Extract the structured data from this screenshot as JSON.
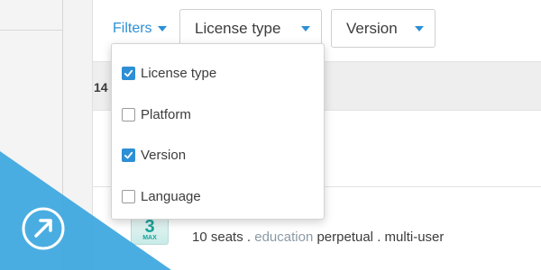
{
  "filters": {
    "label": "Filters",
    "caret_icon": "caret-down-icon",
    "accent": "#2d8fd5"
  },
  "selects": [
    {
      "label": "License type"
    },
    {
      "label": "Version"
    }
  ],
  "dropdown": {
    "options": [
      {
        "label": "License type",
        "checked": true
      },
      {
        "label": "Platform",
        "checked": false
      },
      {
        "label": "Version",
        "checked": true
      },
      {
        "label": "Language",
        "checked": false
      }
    ]
  },
  "list": {
    "count_partial": "14"
  },
  "product": {
    "icon_text": "3",
    "icon_sub": "MAX",
    "seats": "10 seats",
    "sep1": ".",
    "license_kind": "education",
    "term": "perpetual",
    "sep2": ".",
    "usage": "multi-user"
  },
  "corner_badge": {
    "icon": "arrow-up-right-circle-icon",
    "color": "#3ba6e0"
  }
}
